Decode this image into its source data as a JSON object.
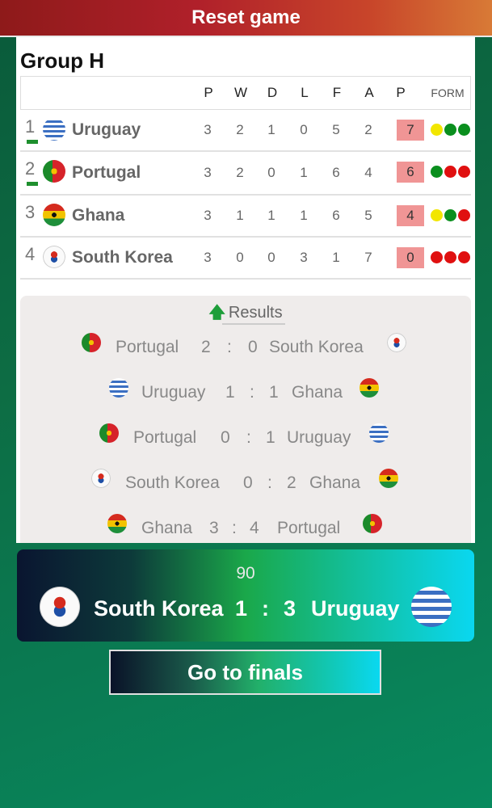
{
  "header": {
    "reset_label": "Reset game"
  },
  "group": {
    "title": "Group H",
    "columns": [
      "P",
      "W",
      "D",
      "L",
      "F",
      "A",
      "P",
      "FORM"
    ],
    "rows": [
      {
        "rank": "1",
        "team": "Uruguay",
        "flag": "uruguay-flag",
        "P": "3",
        "W": "2",
        "D": "1",
        "L": "0",
        "F": "5",
        "A": "2",
        "pts": "7",
        "form": [
          "yellow",
          "green",
          "green"
        ],
        "qualified": true
      },
      {
        "rank": "2",
        "team": "Portugal",
        "flag": "portugal-flag",
        "P": "3",
        "W": "2",
        "D": "0",
        "L": "1",
        "F": "6",
        "A": "4",
        "pts": "6",
        "form": [
          "green",
          "red",
          "red"
        ],
        "qualified": true
      },
      {
        "rank": "3",
        "team": "Ghana",
        "flag": "ghana-flag",
        "P": "3",
        "W": "1",
        "D": "1",
        "L": "1",
        "F": "6",
        "A": "5",
        "pts": "4",
        "form": [
          "yellow",
          "green",
          "red"
        ],
        "qualified": false
      },
      {
        "rank": "4",
        "team": "South Korea",
        "flag": "south-korea-flag",
        "P": "3",
        "W": "0",
        "D": "0",
        "L": "3",
        "F": "1",
        "A": "7",
        "pts": "0",
        "form": [
          "red",
          "red",
          "red"
        ],
        "qualified": false
      }
    ]
  },
  "results": {
    "title": "Results",
    "matches": [
      {
        "home": "Portugal",
        "home_score": "2",
        "sep": ":",
        "away_score": "0",
        "away": "South Korea"
      },
      {
        "home": "Uruguay",
        "home_score": "1",
        "sep": ":",
        "away_score": "1",
        "away": "Ghana"
      },
      {
        "home": "Portugal",
        "home_score": "0",
        "sep": ":",
        "away_score": "1",
        "away": "Uruguay"
      },
      {
        "home": "South Korea",
        "home_score": "0",
        "sep": ":",
        "away_score": "2",
        "away": "Ghana"
      },
      {
        "home": "Ghana",
        "home_score": "3",
        "sep": ":",
        "away_score": "4",
        "away": "Portugal"
      }
    ]
  },
  "live_match": {
    "minute": "90",
    "home": "South Korea",
    "home_score": "1",
    "sep": ":",
    "away_score": "3",
    "away": "Uruguay"
  },
  "finals_button": {
    "label": "Go to finals"
  },
  "colors": {
    "yellow": "#f2e600",
    "green": "#0a8f1e",
    "red": "#e01010",
    "points_bg": "#f09595"
  }
}
